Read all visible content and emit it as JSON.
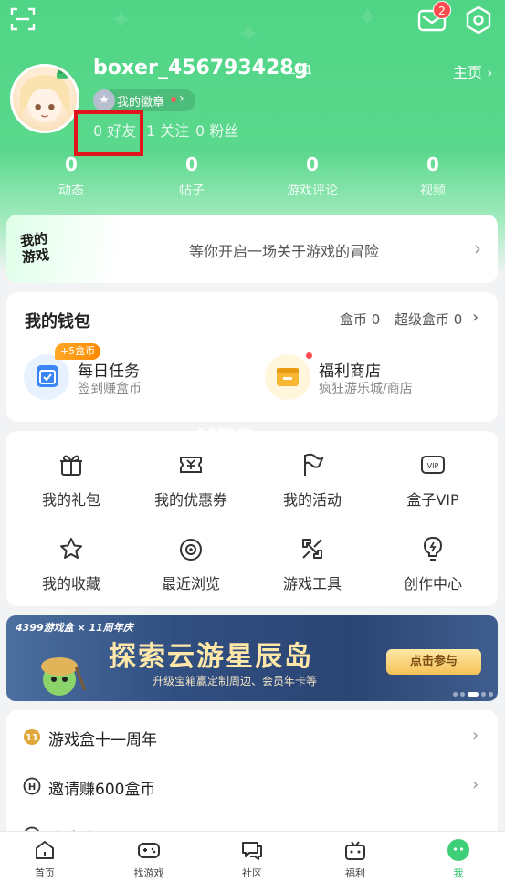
{
  "topbar": {
    "mail_badge": "2",
    "icons": [
      "scan-icon",
      "mail-icon",
      "settings-icon"
    ]
  },
  "profile": {
    "username": "boxer_456793428g",
    "level": "Lv.1",
    "homepage_link": "主页 ›",
    "badge_label": "我的徽章",
    "friends": "0 好友",
    "follow": "1 关注",
    "fans": "0 粉丝"
  },
  "stats": [
    {
      "num": "0",
      "label": "动态"
    },
    {
      "num": "0",
      "label": "帖子"
    },
    {
      "num": "0",
      "label": "游戏评论"
    },
    {
      "num": "0",
      "label": "视频"
    }
  ],
  "adventure": {
    "logo_text": "我的游戏",
    "text": "等你开启一场关于游戏的冒险"
  },
  "wallet": {
    "title": "我的钱包",
    "coins": "盒币 0",
    "super_coins": "超级盒币 0",
    "task_badge": "+5盒币",
    "task_title": "每日任务",
    "task_sub": "签到赚盒币",
    "shop_title": "福利商店",
    "shop_sub": "疯狂游乐城/商店"
  },
  "grid": [
    {
      "label": "我的礼包",
      "icon": "gift-icon"
    },
    {
      "label": "我的优惠券",
      "icon": "coupon-icon"
    },
    {
      "label": "我的活动",
      "icon": "flag-icon"
    },
    {
      "label": "盒子VIP",
      "icon": "vip-icon"
    },
    {
      "label": "我的收藏",
      "icon": "star-icon"
    },
    {
      "label": "最近浏览",
      "icon": "eye-icon"
    },
    {
      "label": "游戏工具",
      "icon": "tool-icon"
    },
    {
      "label": "创作中心",
      "icon": "bulb-icon"
    }
  ],
  "banner": {
    "top_text": "4399游戏盒 × 11周年庆",
    "title": "探索云游星辰岛",
    "subtitle": "升级宝箱赢定制周边、会员年卡等",
    "button": "点击参与"
  },
  "list": [
    {
      "label": "游戏盒十一周年",
      "icon": "anniversary-icon"
    },
    {
      "label": "邀请赚600盒币",
      "icon": "invite-icon"
    },
    {
      "label": "我的访问",
      "icon": "visit-icon"
    }
  ],
  "tabs": [
    {
      "label": "首页",
      "icon": "home-icon"
    },
    {
      "label": "找游戏",
      "icon": "gamepad-icon"
    },
    {
      "label": "社区",
      "icon": "community-icon"
    },
    {
      "label": "福利",
      "icon": "gift-box-icon"
    },
    {
      "label": "我",
      "icon": "me-icon"
    }
  ],
  "watermark": {
    "main": "K73",
    "sub": "游戏之家"
  },
  "colors": {
    "brand_green": "#4fd585",
    "badge_red": "#ff4d4f",
    "highlight_red": "#e0141a"
  }
}
